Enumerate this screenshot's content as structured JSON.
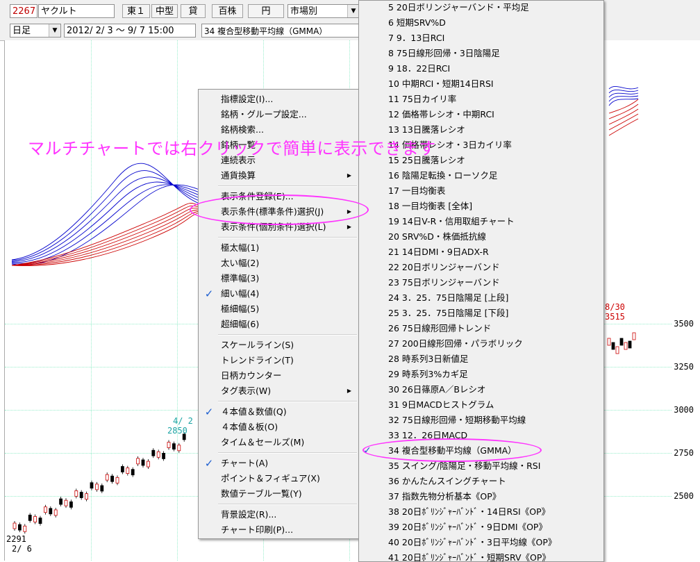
{
  "toolbar": {
    "code": "2267",
    "name": "ヤクルト",
    "market": "東１",
    "size": "中型",
    "loan": "貸",
    "unit": "百株",
    "currency": "円",
    "market_select": "市場別",
    "period_select": "日足",
    "date_range": "2012/ 2/ 3 ～ 9/ 7 15:00",
    "indicator": "34 複合型移動平均線（GMMA）"
  },
  "overlay_caption": "マルチチャートでは右クリックで簡単に表示できます",
  "chart_labels": {
    "prices": [
      "3500",
      "3250",
      "3000",
      "2750",
      "2500"
    ],
    "start_value": "2291",
    "start_date": "2/ 6",
    "peak_date": "4/ 2",
    "peak_value": "2850",
    "right_date": "8/30",
    "right_value": "3515"
  },
  "context_menu": {
    "items": [
      {
        "label": "指標設定(I)...",
        "submenu": false,
        "checked": false
      },
      {
        "label": "銘柄・グループ設定...",
        "submenu": false,
        "checked": false
      },
      {
        "label": "銘柄検索...",
        "submenu": false,
        "checked": false
      },
      {
        "label": "銘柄一覧",
        "submenu": false,
        "checked": false
      },
      {
        "label": "連続表示",
        "submenu": false,
        "checked": false
      },
      {
        "label": "通貨換算",
        "submenu": true,
        "checked": false
      },
      {
        "label": "表示条件登録(E)...",
        "submenu": false,
        "checked": false
      },
      {
        "label": "表示条件(標準条件)選択(J)",
        "submenu": true,
        "checked": false
      },
      {
        "label": "表示条件(個別条件)選択(L)",
        "submenu": true,
        "checked": false
      },
      {
        "label": "極太幅(1)",
        "submenu": false,
        "checked": false
      },
      {
        "label": "太い幅(2)",
        "submenu": false,
        "checked": false
      },
      {
        "label": "標準幅(3)",
        "submenu": false,
        "checked": false
      },
      {
        "label": "細い幅(4)",
        "submenu": false,
        "checked": true
      },
      {
        "label": "極細幅(5)",
        "submenu": false,
        "checked": false
      },
      {
        "label": "超細幅(6)",
        "submenu": false,
        "checked": false
      },
      {
        "label": "スケールライン(S)",
        "submenu": false,
        "checked": false
      },
      {
        "label": "トレンドライン(T)",
        "submenu": false,
        "checked": false
      },
      {
        "label": "日柄カウンター",
        "submenu": false,
        "checked": false
      },
      {
        "label": "タグ表示(W)",
        "submenu": true,
        "checked": false
      },
      {
        "label": "４本値＆数値(Q)",
        "submenu": false,
        "checked": true
      },
      {
        "label": "４本値＆板(O)",
        "submenu": false,
        "checked": false
      },
      {
        "label": "タイム＆セールズ(M)",
        "submenu": false,
        "checked": false
      },
      {
        "label": "チャート(A)",
        "submenu": false,
        "checked": true
      },
      {
        "label": "ポイント＆フィギュア(X)",
        "submenu": false,
        "checked": false
      },
      {
        "label": "数値テーブル一覧(Y)",
        "submenu": false,
        "checked": false
      },
      {
        "label": "背景設定(R)...",
        "submenu": false,
        "checked": false
      },
      {
        "label": "チャート印刷(P)...",
        "submenu": false,
        "checked": false
      }
    ]
  },
  "submenu": {
    "items": [
      "5 20日ボリンジャーバンド・平均足",
      "6 短期SRV%D",
      "7 9．13日RCI",
      "8 75日線形回帰・3日陰陽足",
      "9 18．22日RCI",
      "10 中期RCI・短期14日RSI",
      "11 75日カイリ率",
      "12 価格帯レシオ・中期RCI",
      "13 13日騰落レシオ",
      "14 価格帯レシオ・3日カイリ率",
      "15 25日騰落レシオ",
      "16 陰陽足転換・ローソク足",
      "17 一目均衡表",
      "18 一目均衡表 [全体]",
      "19 14日V-R・信用取組チャート",
      "20 SRV%D・株価抵抗線",
      "21 14日DMI・9日ADX-R",
      "22 20日ボリンジャーバンド",
      "23 75日ボリンジャーバンド",
      "24 3．25．75日陰陽足 [上段]",
      "25 3．25．75日陰陽足 [下段]",
      "26 75日線形回帰トレンド",
      "27 200日線形回帰・パラボリック",
      "28 時系列3日新値足",
      "29 時系列3%カギ足",
      "30 26日篠原A／Bレシオ",
      "31 9日MACDヒストグラム",
      "32 75日線形回帰・短期移動平均線",
      "33 12．26日MACD",
      "34 複合型移動平均線（GMMA）",
      "35 スイング/陰陽足・移動平均線・RSI",
      "36 かんたんスイングチャート",
      "37 指数先物分析基本《OP》",
      "38 20日ﾎﾞﾘﾝｼﾞｬｰﾊﾞﾝﾄﾞ・14日RSI《OP》",
      "39 20日ﾎﾞﾘﾝｼﾞｬｰﾊﾞﾝﾄﾞ・9日DMI《OP》",
      "40 20日ﾎﾞﾘﾝｼﾞｬｰﾊﾞﾝﾄﾞ・3日平均線《OP》",
      "41 20日ﾎﾞﾘﾝｼﾞｬｰﾊﾞﾝﾄﾞ・短期SRV《OP》"
    ],
    "checked_index": 29
  },
  "check_mark": "✓",
  "colors": {
    "highlight": "#ff33ff",
    "code_red": "#c00000",
    "gmma_short": "#0000cc",
    "gmma_long": "#cc0000"
  }
}
